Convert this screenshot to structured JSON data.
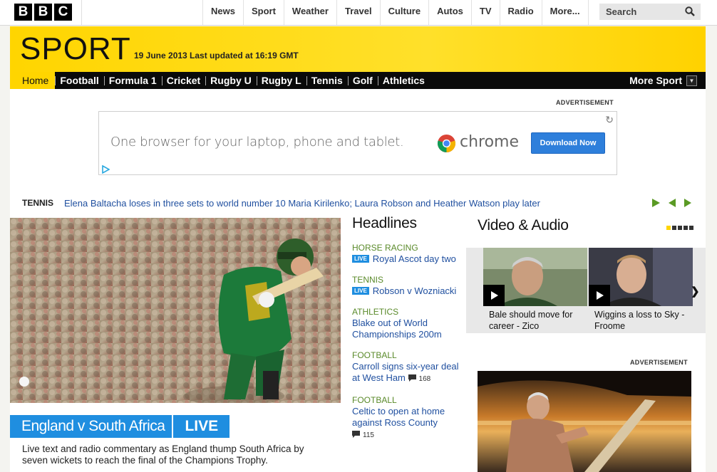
{
  "brand": {
    "letters": [
      "B",
      "B",
      "C"
    ]
  },
  "topnav": {
    "items": [
      "News",
      "Sport",
      "Weather",
      "Travel",
      "Culture",
      "Autos",
      "TV",
      "Radio",
      "More..."
    ],
    "search_label": "Search"
  },
  "banner": {
    "title": "SPORT",
    "date_line": "19 June 2013 Last updated at 16:19 GMT",
    "accent_color": "#ffd500"
  },
  "sport_nav": {
    "tabs": [
      "Home",
      "Football",
      "Formula 1",
      "Cricket",
      "Rugby U",
      "Rugby L",
      "Tennis",
      "Golf",
      "Athletics"
    ],
    "active": "Home",
    "more_label": "More Sport"
  },
  "top_ad": {
    "label": "ADVERTISEMENT",
    "tagline": "One browser for your laptop, phone and tablet.",
    "brand_word": "chrome",
    "button_label": "Download Now"
  },
  "ticker": {
    "label": "TENNIS",
    "text": "Elena Baltacha loses in three sets to world number 10 Maria Kirilenko; Laura Robson and Heather Watson play later"
  },
  "main_story": {
    "title": "England v South Africa",
    "live_label": "LIVE",
    "summary": "Live text and radio commentary as England thump South Africa by seven wickets to reach the final of the Champions Trophy."
  },
  "headlines": {
    "title": "Headlines",
    "items": [
      {
        "category": "HORSE RACING",
        "live": "LIVE",
        "text": "Royal Ascot day two"
      },
      {
        "category": "TENNIS",
        "live": "LIVE",
        "text": "Robson v Wozniacki"
      },
      {
        "category": "ATHLETICS",
        "text": "Blake out of World Championships 200m"
      },
      {
        "category": "FOOTBALL",
        "text": "Carroll signs six-year deal at West Ham",
        "comments": "168"
      },
      {
        "category": "FOOTBALL",
        "text": "Celtic to open at home against Ross County",
        "comments": "115"
      }
    ]
  },
  "video_audio": {
    "title": "Video & Audio",
    "items": [
      {
        "caption": "Bale should move for career - Zico"
      },
      {
        "caption": "Wiggins a loss to Sky - Froome"
      }
    ]
  },
  "side_ad": {
    "label": "ADVERTISEMENT"
  }
}
